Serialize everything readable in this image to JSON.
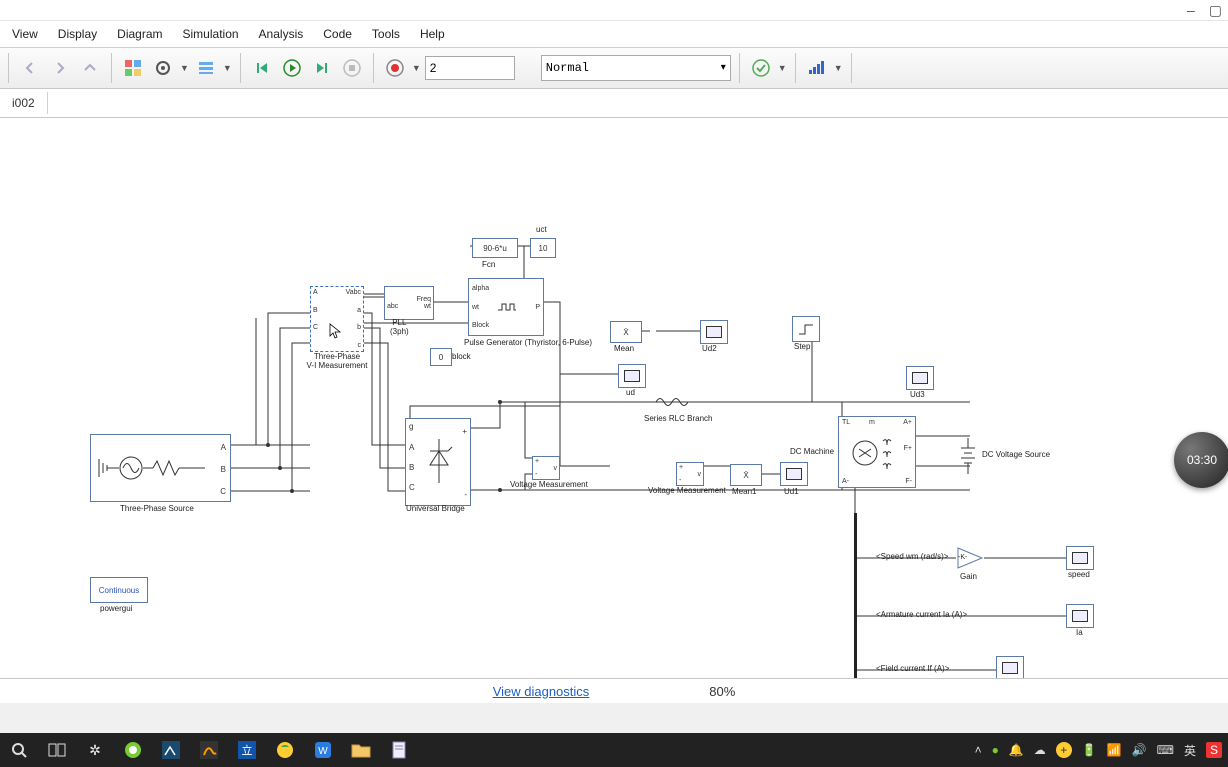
{
  "window": {
    "minimize": "–",
    "maximize": "▢"
  },
  "menu": {
    "view": "View",
    "display": "Display",
    "diagram": "Diagram",
    "simulation": "Simulation",
    "analysis": "Analysis",
    "code": "Code",
    "tools": "Tools",
    "help": "Help"
  },
  "toolbar": {
    "stop_time": "2",
    "mode": "Normal"
  },
  "tab": {
    "name": "i002"
  },
  "status": {
    "diagnostics": "View diagnostics",
    "zoom": "80%"
  },
  "floating_time": "03:30",
  "blocks": {
    "uct": "uct",
    "fcn_expr": "90-6*u",
    "const10": "10",
    "fcn_lbl": "Fcn",
    "alpha": "alpha",
    "wt": "wt",
    "block_port": "Block",
    "freq": "Freq",
    "abc": "abc",
    "wt2": "wt",
    "p": "P",
    "pl": "PL",
    "pll_label": "PLL\n(3ph)",
    "vabc": "Vabc",
    "tp_meas_a": "A",
    "tp_meas_b": "B",
    "tp_meas_c": "C",
    "tp_meas_la": "a",
    "tp_meas_lb": "b",
    "tp_meas_lc": "c",
    "tp_meas_label": "Three-Phase\nV-I Measurement",
    "const0": "0",
    "block_txt": "block",
    "pulse_gen": "Pulse Generator\n(Thyristor, 6-Pulse)",
    "mean": "Mean",
    "xbar": "X̄",
    "ud2": "Ud2",
    "step": "Step",
    "ud": "ud",
    "ud3": "Ud3",
    "rlc": "Series RLC Branch",
    "dc_machine": "DC Machine",
    "dc_source": "DC Voltage Source",
    "vmeas1": "Voltage Measurement",
    "vmeas2": "Voltage Measurement",
    "mean1": "Mean1",
    "ud1": "Ud1",
    "ub_label": "Universal Bridge",
    "ub_g": "g",
    "ub_a": "A",
    "ub_b": "B",
    "ub_c": "C",
    "ub_p": "+",
    "ub_m": "-",
    "src_label": "Three-Phase Source",
    "src_a": "A",
    "src_b": "B",
    "src_c": "C",
    "powergui": "Continuous",
    "powergui_lbl": "powergui",
    "speed_tag": "<Speed wm (rad/s)>",
    "gain": "-K-",
    "gain_lbl": "Gain",
    "speed_lbl": "speed",
    "arm_tag": "<Armature current Ia (A)>",
    "ia_lbl": "Ia",
    "field_tag": "<Field current If (A)>",
    "dc_tl": "TL",
    "dc_m": "m",
    "dc_ap": "A+",
    "dc_am": "A-",
    "dc_fp": "F+",
    "dc_fm": "F-",
    "plus": "+",
    "minus": "-",
    "v": "v"
  },
  "taskbar": {
    "ime": "英"
  }
}
